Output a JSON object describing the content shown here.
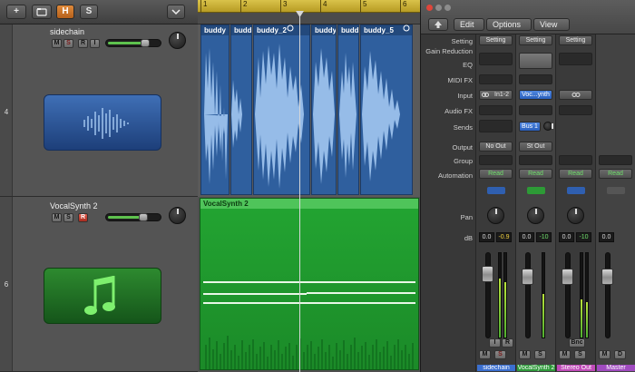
{
  "toolbar": {
    "add_label": "+",
    "h_label": "H",
    "s_label": "S",
    "collapse_icon": "chevron-down-icon"
  },
  "tracks": [
    {
      "number": "4",
      "name": "sidechain",
      "btns": [
        "M",
        "S",
        "R",
        "I"
      ],
      "volume_fraction": 0.7
    },
    {
      "number": "6",
      "name": "VocalSynth 2",
      "btns": [
        "M",
        "S",
        "R"
      ],
      "volume_fraction": 0.68
    }
  ],
  "ruler": {
    "marks": [
      "1",
      "2",
      "3",
      "4",
      "5",
      "6"
    ]
  },
  "regions_top": [
    "buddy",
    "buddy",
    "buddy_2",
    "buddy_",
    "buddy",
    "buddy_5"
  ],
  "region_bottom": "VocalSynth 2",
  "colors": {
    "audio_region": "#2f5f9e",
    "midi_region": "#1f9a2c",
    "ruler": "#cdb437",
    "green_accent": "#5ec24e",
    "record_red": "#c0392b"
  },
  "mixer": {
    "menus": {
      "edit": "Edit",
      "options": "Options",
      "view": "View"
    },
    "row_labels": {
      "setting": "Setting",
      "gain": "Gain Reduction",
      "eq": "EQ",
      "midi_fx": "MIDI FX",
      "input": "Input",
      "audio_fx": "Audio FX",
      "sends": "Sends",
      "output": "Output",
      "group": "Group",
      "automation": "Automation",
      "pan": "Pan",
      "db": "dB"
    },
    "strips": [
      {
        "setting": "Setting",
        "input": "In1-2",
        "send": "",
        "output": "No Out",
        "automation": "Read",
        "db_a": "0.0",
        "db_b": "-0.9",
        "io_a": "I",
        "io_b": "R",
        "mute": "M",
        "solo": "S",
        "name": "sidechain",
        "name_color": "#3b6fcf"
      },
      {
        "setting": "Setting",
        "input": "Voc...ynth",
        "send": "Bus 1",
        "output": "St Out",
        "automation": "Read",
        "db_a": "0.0",
        "db_b": "-10",
        "io_a": "",
        "io_b": "",
        "mute": "M",
        "solo": "S",
        "name": "VocalSynth 2",
        "name_color": "#2e9a3a"
      },
      {
        "setting": "Setting",
        "input": "",
        "send": "",
        "output": "",
        "automation": "Read",
        "db_a": "0.0",
        "db_b": "-10",
        "io_a": "Bnc",
        "io_b": "",
        "mute": "M",
        "solo": "S",
        "name": "Stereo Out",
        "name_color": "#c04bb8"
      },
      {
        "setting": "",
        "input": "",
        "send": "",
        "output": "",
        "automation": "Read",
        "db_a": "0.0",
        "db_b": "",
        "io_a": "",
        "io_b": "",
        "mute": "M",
        "solo": "D",
        "name": "Master",
        "name_color": "#a04bc0"
      }
    ]
  }
}
